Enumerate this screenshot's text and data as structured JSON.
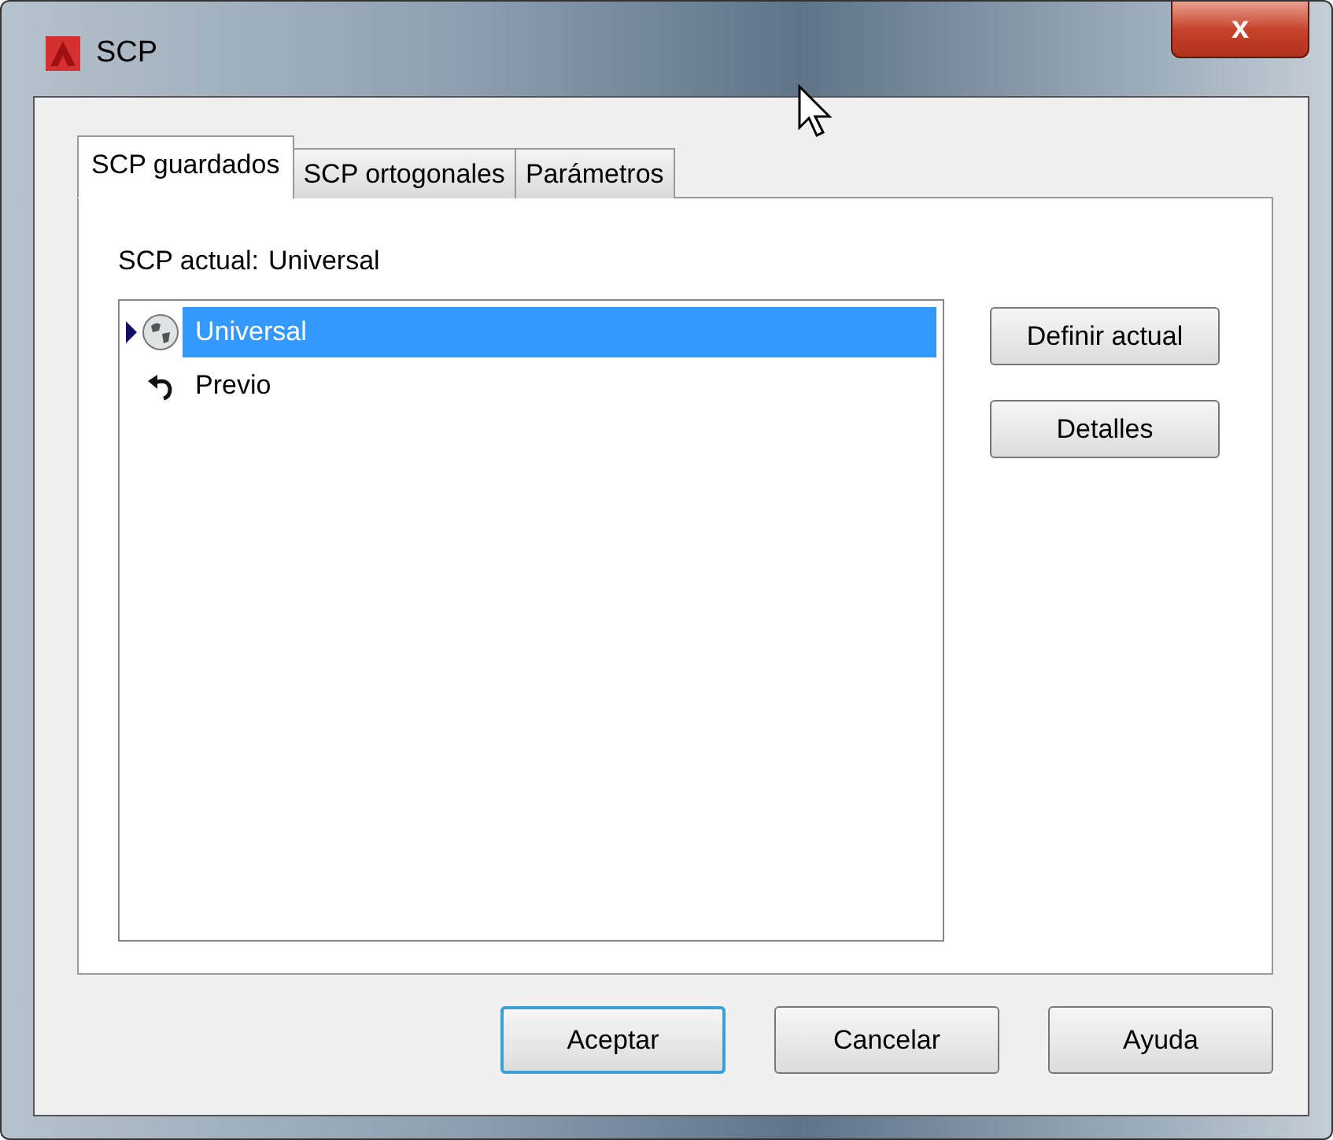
{
  "window": {
    "title": "SCP",
    "close": "x"
  },
  "tabs": [
    {
      "label": "SCP guardados",
      "selected": true
    },
    {
      "label": "SCP ortogonales",
      "selected": false
    },
    {
      "label": "Parámetros",
      "selected": false
    }
  ],
  "current": {
    "label": "SCP actual:",
    "value": "Universal"
  },
  "list": [
    {
      "label": "Universal",
      "kind": "globe",
      "selected": true
    },
    {
      "label": "Previo",
      "kind": "previous",
      "selected": false
    }
  ],
  "side_buttons": [
    "Definir actual",
    "Detalles"
  ],
  "buttons": [
    {
      "label": "Aceptar",
      "default": true
    },
    {
      "label": "Cancelar",
      "default": false
    },
    {
      "label": "Ayuda",
      "default": false
    }
  ]
}
